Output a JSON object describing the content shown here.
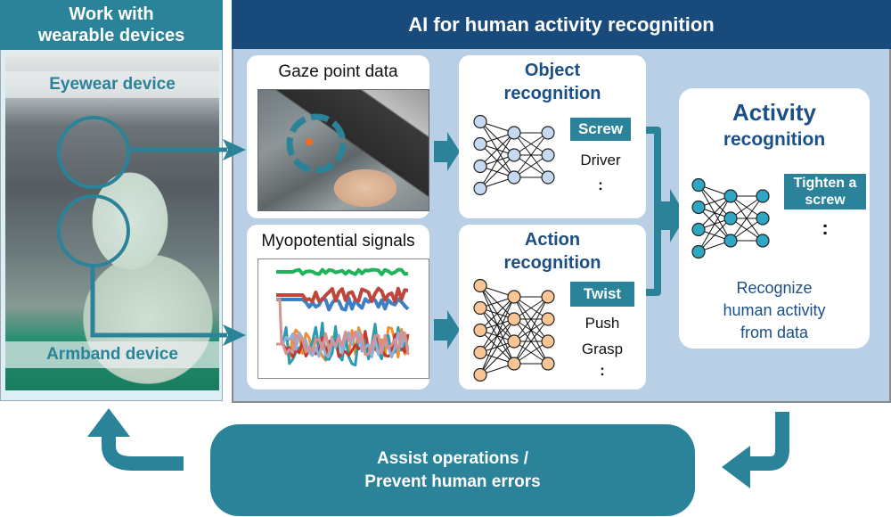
{
  "left_panel": {
    "title_line1": "Work with",
    "title_line2": "wearable devices",
    "eyewear_label": "Eyewear device",
    "armband_label": "Armband device"
  },
  "main_panel": {
    "title": "AI for human activity recognition",
    "gaze": {
      "title": "Gaze point data"
    },
    "myo": {
      "title": "Myopotential signals"
    },
    "object_recognition": {
      "title_line1": "Object",
      "title_line2": "recognition",
      "selected_output": "Screw",
      "outputs": [
        "Driver",
        ":"
      ],
      "node_color": "#c5d9f0"
    },
    "action_recognition": {
      "title_line1": "Action",
      "title_line2": "recognition",
      "selected_output": "Twist",
      "outputs": [
        "Push",
        "Grasp",
        ":"
      ],
      "node_color": "#f9c595"
    },
    "activity_recognition": {
      "title_line1": "Activity",
      "title_line2": "recognition",
      "selected_output_line1": "Tighten a",
      "selected_output_line2": "screw",
      "more": ":",
      "description_line1": "Recognize",
      "description_line2": "human activity",
      "description_line3": "from data",
      "node_color": "#2fa6c2"
    }
  },
  "feedback": {
    "line1": "Assist operations /",
    "line2": "Prevent human errors"
  },
  "colors": {
    "teal": "#2a8399",
    "navy": "#194a7c",
    "panel_blue": "#b9cfe5",
    "left_bg": "#ddeef4"
  }
}
